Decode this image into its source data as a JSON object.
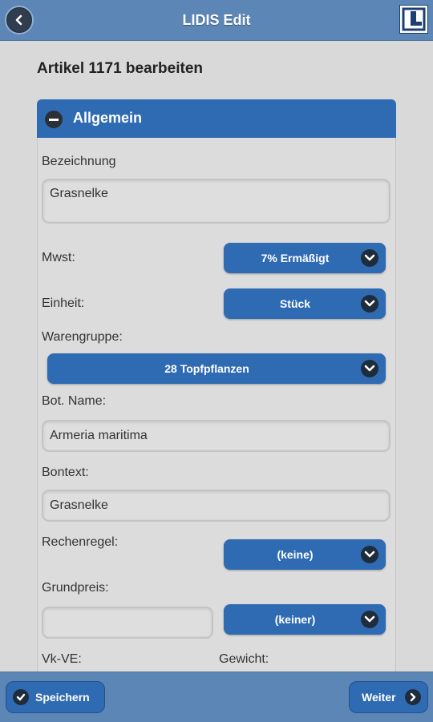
{
  "header": {
    "title": "LIDIS Edit"
  },
  "page": {
    "heading": "Artikel 1171 bearbeiten"
  },
  "section": {
    "title": "Allgemein"
  },
  "form": {
    "bezeichnung": {
      "label": "Bezeichnung",
      "value": "Grasnelke"
    },
    "mwst": {
      "label": "Mwst:",
      "selected": "7% Ermäßigt"
    },
    "einheit": {
      "label": "Einheit:",
      "selected": "Stück"
    },
    "warengruppe": {
      "label": "Warengruppe:",
      "selected": "28 Topfpflanzen"
    },
    "bot_name": {
      "label": "Bot. Name:",
      "value": "Armeria maritima"
    },
    "bontext": {
      "label": "Bontext:",
      "value": "Grasnelke"
    },
    "rechenregel": {
      "label": "Rechenregel:",
      "selected": "(keine)"
    },
    "grundpreis": {
      "label": "Grundpreis:",
      "value": "",
      "unit_selected": "(keiner)"
    },
    "vk_ve": {
      "label": "Vk-VE:"
    },
    "gewicht": {
      "label": "Gewicht:"
    }
  },
  "footer": {
    "save_label": "Speichern",
    "next_label": "Weiter"
  },
  "colors": {
    "accent": "#2f6bb3",
    "bar": "#5b86b6",
    "background": "#d9d9d9"
  },
  "icons": {
    "back": "chevron-left-icon",
    "logo": "lidis-logo",
    "collapse": "minus-circle-icon",
    "dropdown": "chevron-down-icon",
    "save": "check-icon",
    "next": "chevron-right-icon"
  }
}
